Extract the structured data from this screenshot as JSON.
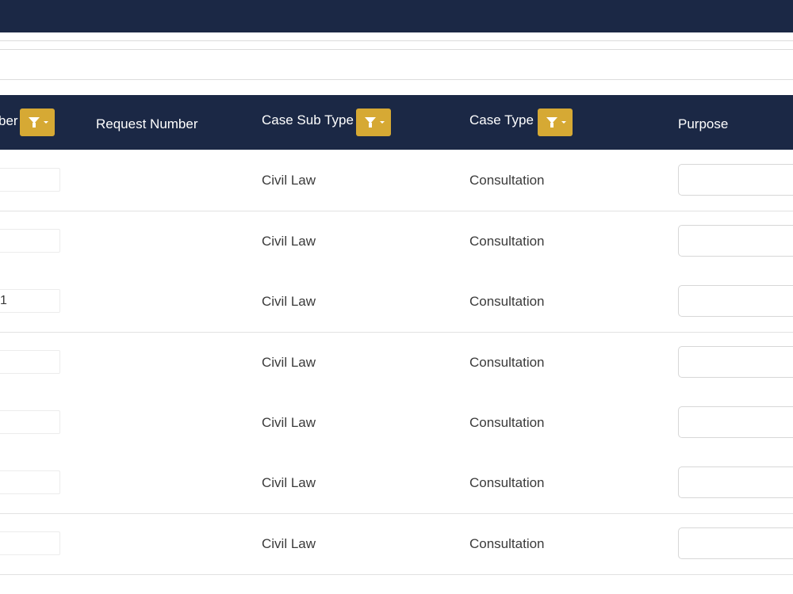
{
  "header": {
    "columns": [
      {
        "label": "ber",
        "has_filter": true
      },
      {
        "label": "Request Number",
        "has_filter": false
      },
      {
        "label": "Case Sub Type",
        "has_filter": true
      },
      {
        "label": "Case Type",
        "has_filter": true
      },
      {
        "label": "Purpose",
        "has_filter": false
      }
    ],
    "filter_icon": "funnel-dropdown-icon"
  },
  "rows": [
    {
      "number": "",
      "request_number": "",
      "case_sub_type": "Civil Law",
      "case_type": "Consultation",
      "purpose": ""
    },
    {
      "number": "",
      "request_number": "",
      "case_sub_type": "Civil Law",
      "case_type": "Consultation",
      "purpose": ""
    },
    {
      "number": "1",
      "request_number": "",
      "case_sub_type": "Civil Law",
      "case_type": "Consultation",
      "purpose": ""
    },
    {
      "number": "",
      "request_number": "",
      "case_sub_type": "Civil Law",
      "case_type": "Consultation",
      "purpose": ""
    },
    {
      "number": "",
      "request_number": "",
      "case_sub_type": "Civil Law",
      "case_type": "Consultation",
      "purpose": ""
    },
    {
      "number": "",
      "request_number": "",
      "case_sub_type": "Civil Law",
      "case_type": "Consultation",
      "purpose": ""
    },
    {
      "number": "",
      "request_number": "",
      "case_sub_type": "Civil Law",
      "case_type": "Consultation",
      "purpose": ""
    }
  ],
  "colors": {
    "navy": "#1b2845",
    "filter_gold": "#d6a934",
    "text": "#3a3a3a",
    "header_text": "#ffffff"
  }
}
